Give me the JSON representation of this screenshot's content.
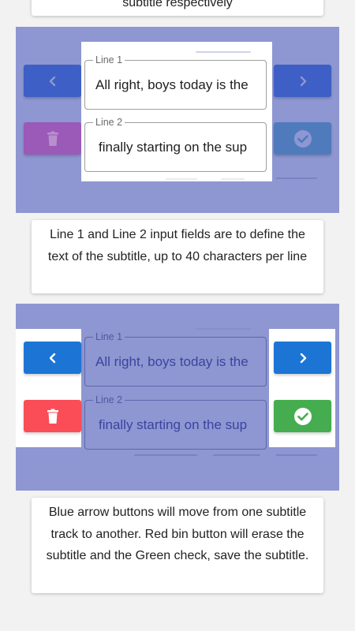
{
  "cards": {
    "top_text": "subtitle respectively",
    "middle_text": "Line 1 and Line 2 input fields are to define the text of the subtitle, up to 40 characters per line",
    "bottom_text": "Blue arrow buttons will move from one subtitle track to another. Red bin button will erase the subtitle and the Green check, save the subtitle."
  },
  "editor": {
    "line1_label": "Line 1",
    "line1_value": "All right, boys today is the",
    "line2_label": "Line 2",
    "line2_value": "finally starting on the sup"
  },
  "icons": {
    "prev": "chevron-left-icon",
    "next": "chevron-right-icon",
    "delete": "trash-icon",
    "save": "check-circle-icon"
  },
  "colors": {
    "overlay": "#8e97d1",
    "blue_button": "#1c75d5",
    "red_button": "#fa4d57",
    "green_button": "#45ad4f",
    "dim_blue_button": "#3e5fc5",
    "dim_purple_button": "#9b59b8",
    "dim_teal_button": "#4f7bbd"
  }
}
